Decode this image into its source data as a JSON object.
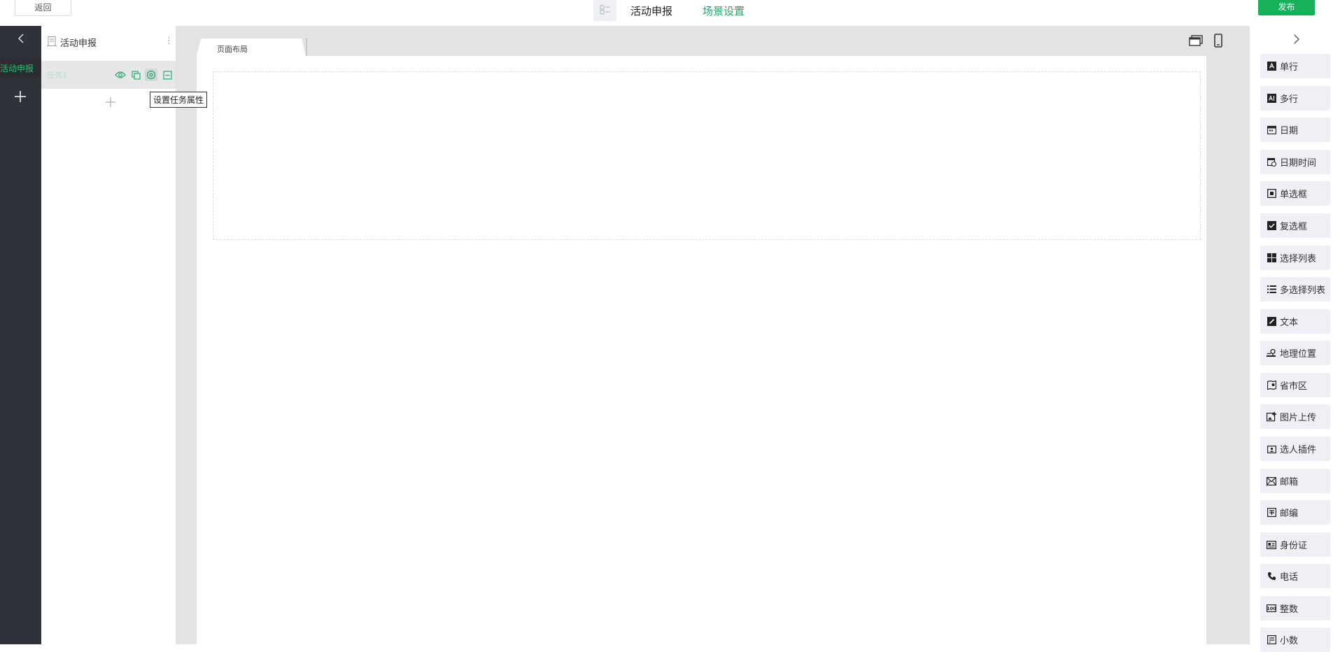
{
  "topbar": {
    "back_label": "返回",
    "tab_activity": "活动申报",
    "tab_scene_settings": "场景设置",
    "publish_label": "发布"
  },
  "rail": {
    "active_item": "活动申报"
  },
  "scene": {
    "title": "活动申报",
    "more_glyph": "⋮",
    "task_name": "任务1",
    "tooltip": "设置任务属性"
  },
  "canvas": {
    "page_tab": "页面布局"
  },
  "widgets": [
    {
      "label": "单行",
      "icon": "single-line-text-icon"
    },
    {
      "label": "多行",
      "icon": "multi-line-text-icon"
    },
    {
      "label": "日期",
      "icon": "calendar-icon"
    },
    {
      "label": "日期时间",
      "icon": "calendar-clock-icon"
    },
    {
      "label": "单选框",
      "icon": "radio-icon"
    },
    {
      "label": "复选框",
      "icon": "checkbox-icon"
    },
    {
      "label": "选择列表",
      "icon": "grid-list-icon"
    },
    {
      "label": "多选择列表",
      "icon": "bullet-list-icon"
    },
    {
      "label": "文本",
      "icon": "edit-text-icon"
    },
    {
      "label": "地理位置",
      "icon": "location-icon"
    },
    {
      "label": "省市区",
      "icon": "map-icon"
    },
    {
      "label": "图片上传",
      "icon": "image-upload-icon"
    },
    {
      "label": "选人插件",
      "icon": "person-picker-icon"
    },
    {
      "label": "邮箱",
      "icon": "mail-icon"
    },
    {
      "label": "邮编",
      "icon": "postcode-icon"
    },
    {
      "label": "身份证",
      "icon": "id-card-icon"
    },
    {
      "label": "电话",
      "icon": "phone-icon"
    },
    {
      "label": "整数",
      "icon": "integer-icon"
    },
    {
      "label": "小数",
      "icon": "decimal-icon"
    }
  ],
  "colors": {
    "accent_green": "#18b15a",
    "rail_bg": "#30323a",
    "canvas_bg": "#e3e3e3",
    "widget_bg": "#eef0f5"
  }
}
